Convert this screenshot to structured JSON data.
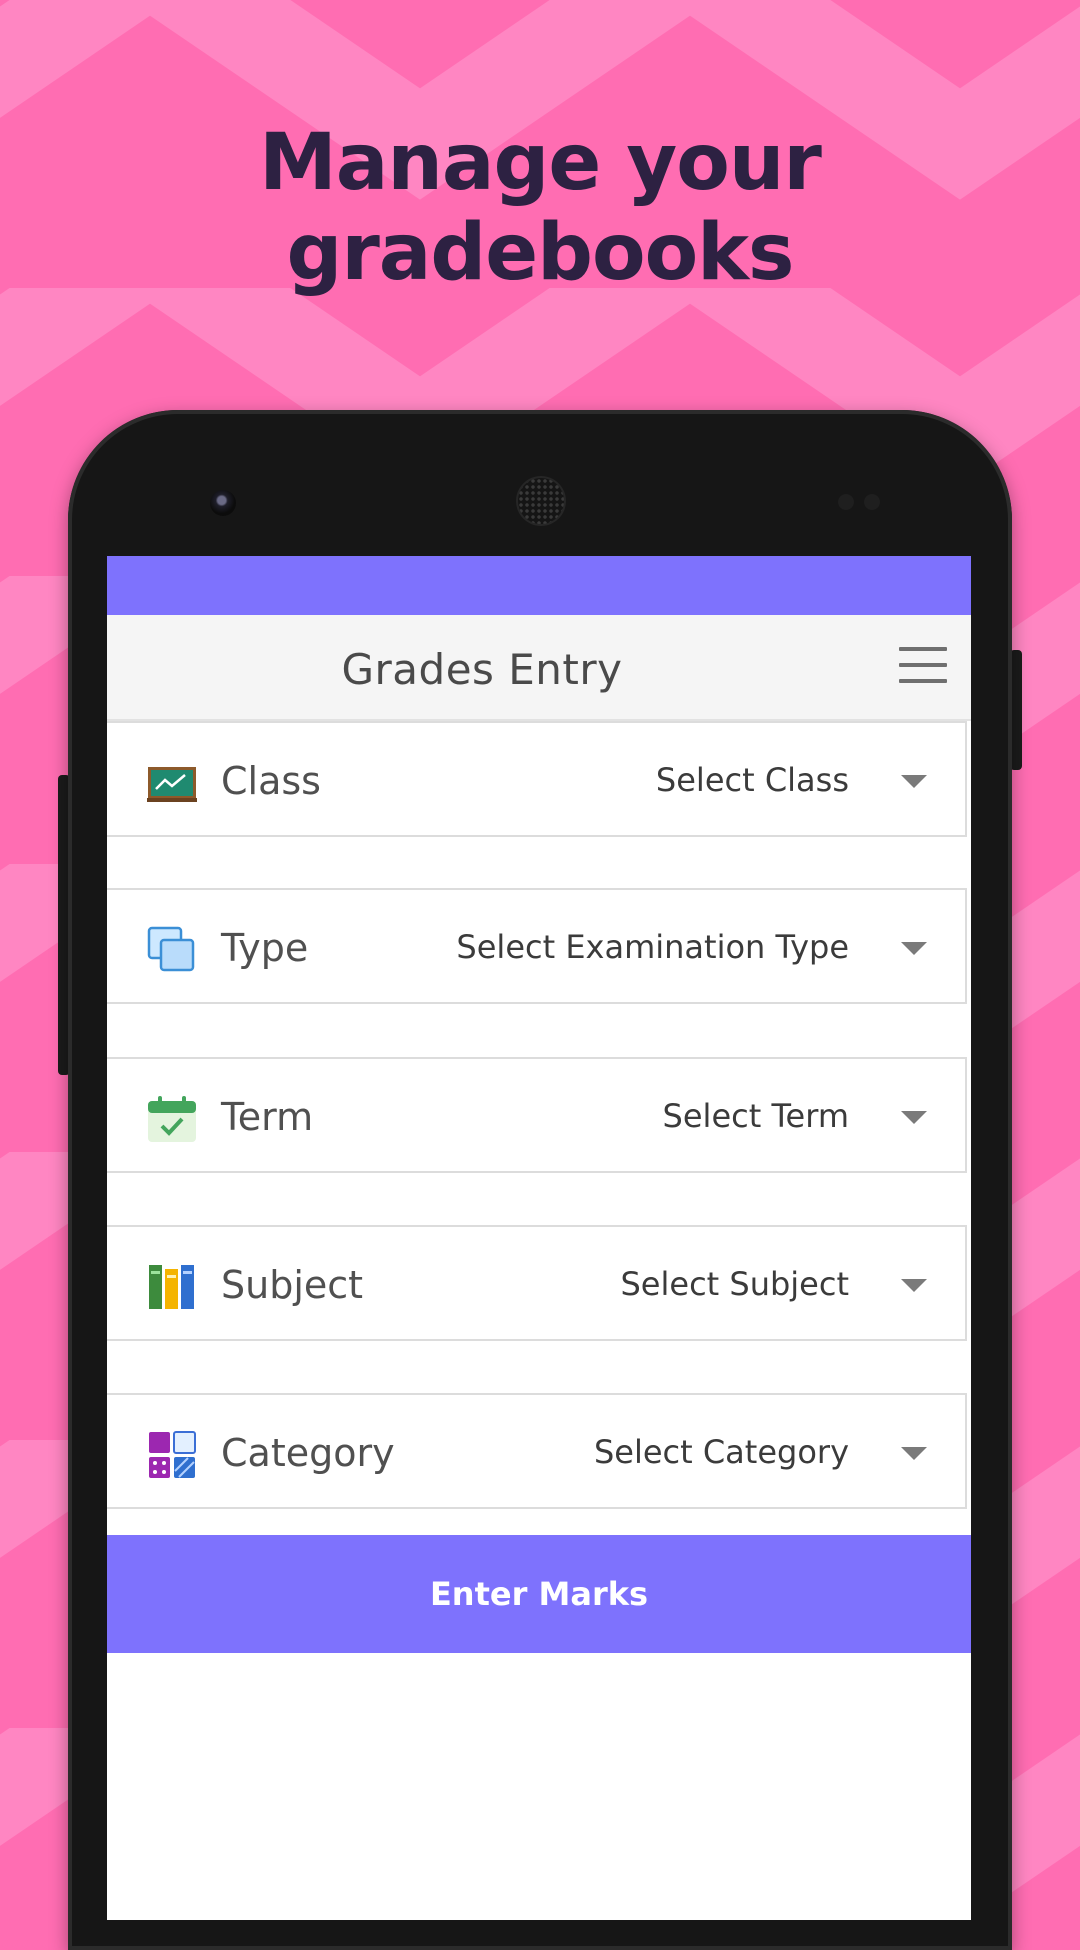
{
  "promo": {
    "headline": "Manage your gradebooks"
  },
  "colors": {
    "background_pink": "#ff6db2",
    "background_stripe": "#ff86c2",
    "accent_purple": "#7e72fd",
    "headline_text": "#2d2142"
  },
  "app_bar": {
    "title": "Grades Entry",
    "menu_icon": "hamburger-menu-icon"
  },
  "fields": [
    {
      "label": "Class",
      "value": "Select Class",
      "icon": "chalkboard-icon"
    },
    {
      "label": "Type",
      "value": "Select Examination Type",
      "icon": "layers-icon"
    },
    {
      "label": "Term",
      "value": "Select Term",
      "icon": "calendar-check-icon"
    },
    {
      "label": "Subject",
      "value": "Select Subject",
      "icon": "books-icon"
    },
    {
      "label": "Category",
      "value": "Select Category",
      "icon": "category-grid-icon"
    }
  ],
  "actions": {
    "enter_marks": "Enter Marks"
  }
}
